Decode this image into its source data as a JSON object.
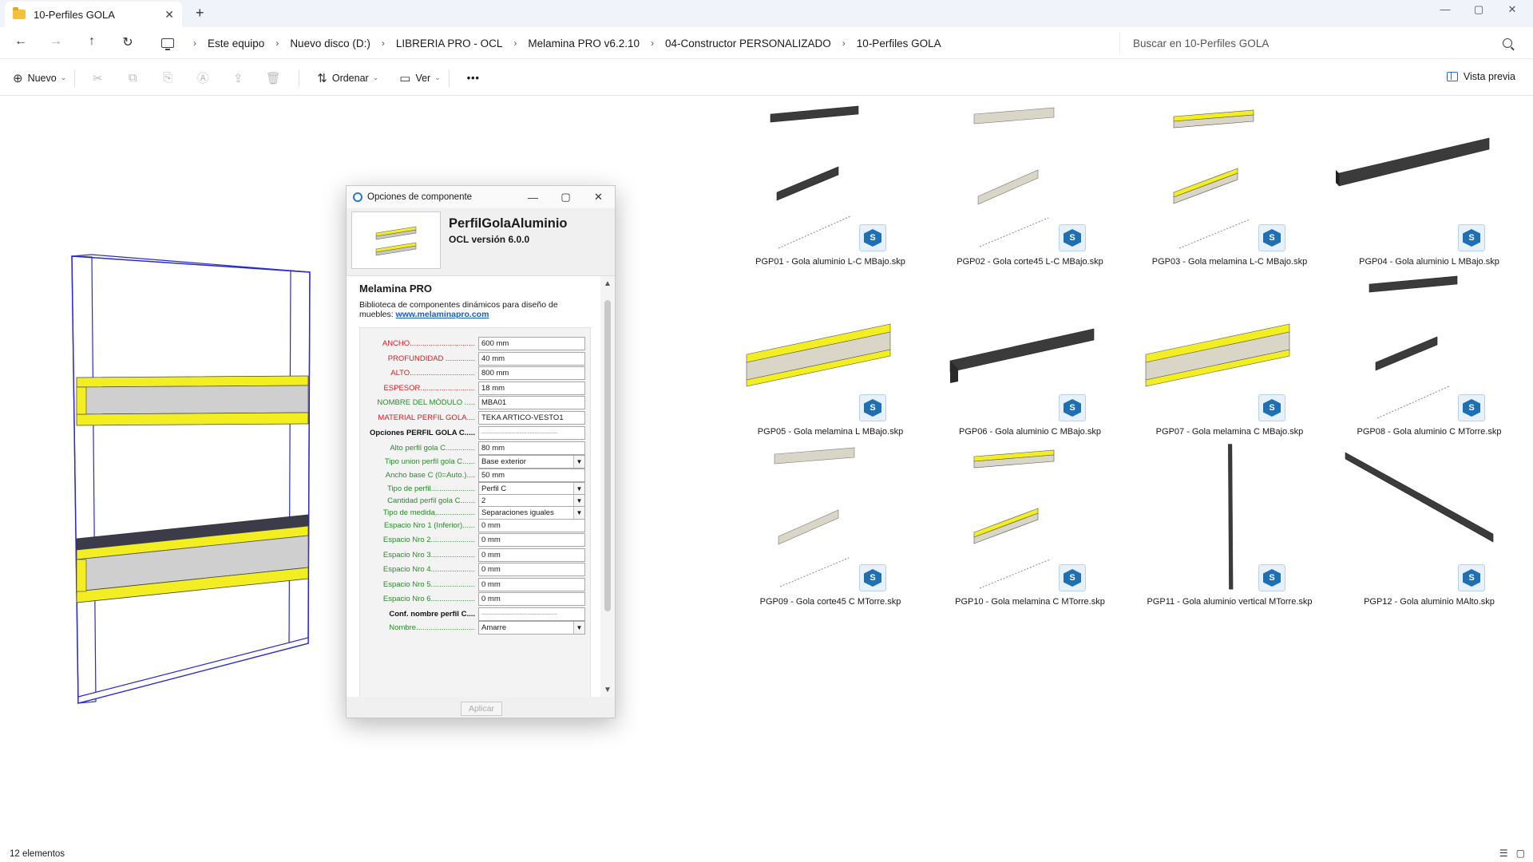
{
  "window": {
    "tab_title": "10-Perfiles GOLA",
    "tab_close": "✕",
    "new_tab": "+",
    "controls": {
      "minimize": "—",
      "maximize": "▢",
      "close": "✕"
    }
  },
  "nav": {
    "back": "←",
    "forward": "→",
    "up": "↑",
    "refresh": "↻",
    "breadcrumbs": [
      "Este equipo",
      "Nuevo disco (D:)",
      "LIBRERIA PRO - OCL",
      "Melamina PRO v6.2.10",
      "04-Constructor PERSONALIZADO",
      "10-Perfiles GOLA"
    ],
    "separator": "›",
    "search_placeholder": "Buscar en 10-Perfiles GOLA"
  },
  "commandbar": {
    "new_label": "Nuevo",
    "new_icon": "⊕",
    "sort_label": "Ordenar",
    "sort_icon": "⇅",
    "view_label": "Ver",
    "view_icon": "▭",
    "more": "•••",
    "preview_label": "Vista previa",
    "icons": [
      "✂",
      "⧉",
      "⎘",
      "Ⓐ",
      "⇪",
      "🗑"
    ]
  },
  "dialog": {
    "title": "Opciones de componente",
    "controls": {
      "minimize": "—",
      "maximize": "▢",
      "close": "✕"
    },
    "component_name": "PerfilGolaAluminio",
    "version": "OCL versión 6.0.0",
    "brand": "Melamina PRO",
    "description": "Biblioteca de componentes dinámicos para diseño de muebles:",
    "link": "www.melaminapro.com",
    "apply_label": "Aplicar",
    "fields": [
      {
        "label": "ANCHO...............................",
        "value": "600 mm",
        "color": "red",
        "type": "input"
      },
      {
        "label": "PROFUNDIDAD ..............",
        "value": "40 mm",
        "color": "red",
        "type": "input"
      },
      {
        "label": "ALTO...............................",
        "value": "800 mm",
        "color": "red",
        "type": "input"
      },
      {
        "label": "ESPESOR..........................",
        "value": "18 mm",
        "color": "red",
        "type": "input"
      },
      {
        "label": "NOMBRE DEL MÓDULO .....",
        "value": "MBA01",
        "color": "green",
        "type": "input"
      },
      {
        "label": "MATERIAL PERFIL GOLA....",
        "value": "TEKA ARTICO-VESTO1",
        "color": "red",
        "type": "input"
      },
      {
        "label": "Opciones PERFIL GOLA C.....",
        "value": "------------------------------",
        "color": "bold",
        "type": "dashed"
      },
      {
        "label": "Alto perfil gola C..............",
        "value": "80 mm",
        "color": "green",
        "type": "input"
      },
      {
        "label": "Tipo union perfil gola C......",
        "value": "Base exterior",
        "color": "green",
        "type": "select"
      },
      {
        "label": "Ancho base C (0=Auto.)....",
        "value": "50 mm",
        "color": "green",
        "type": "input"
      },
      {
        "label": "Tipo de perfil.....................",
        "value": "Perfil C",
        "color": "green",
        "type": "select"
      },
      {
        "label": "Cantidad perfil gola C.......",
        "value": "2",
        "color": "green",
        "type": "select"
      },
      {
        "label": "Tipo de medida...................",
        "value": "Separaciones iguales",
        "color": "green",
        "type": "select"
      },
      {
        "label": "Espacio Nro 1 (Inferior)......",
        "value": "0 mm",
        "color": "green",
        "type": "input"
      },
      {
        "label": "Espacio Nro 2.....................",
        "value": "0 mm",
        "color": "green",
        "type": "input"
      },
      {
        "label": "Espacio Nro 3.....................",
        "value": "0 mm",
        "color": "green",
        "type": "input"
      },
      {
        "label": "Espacio Nro 4.....................",
        "value": "0 mm",
        "color": "green",
        "type": "input"
      },
      {
        "label": "Espacio Nro 5.....................",
        "value": "0 mm",
        "color": "green",
        "type": "input"
      },
      {
        "label": "Espacio Nro 6.....................",
        "value": "0 mm",
        "color": "green",
        "type": "input"
      },
      {
        "label": "Conf. nombre perfil C....",
        "value": "------------------------------",
        "color": "bold",
        "type": "dashed"
      },
      {
        "label": "Nombre............................",
        "value": "Amarre",
        "color": "green",
        "type": "select"
      }
    ]
  },
  "files": [
    {
      "name": "PGP01 - Gola aluminio L-C MBajo.skp",
      "style": "dark-pair"
    },
    {
      "name": "PGP02 - Gola corte45 L-C MBajo.skp",
      "style": "light-pair"
    },
    {
      "name": "PGP03 - Gola melamina L-C MBajo.skp",
      "style": "yellow-pair"
    },
    {
      "name": "PGP04 - Gola aluminio L MBajo.skp",
      "style": "dark-long"
    },
    {
      "name": "PGP05 - Gola melamina L MBajo.skp",
      "style": "yellow-big"
    },
    {
      "name": "PGP06 - Gola aluminio C MBajo.skp",
      "style": "dark-big"
    },
    {
      "name": "PGP07 - Gola melamina C MBajo.skp",
      "style": "yellow-big"
    },
    {
      "name": "PGP08 - Gola aluminio C MTorre.skp",
      "style": "dark-pair"
    },
    {
      "name": "PGP09 - Gola corte45 C MTorre.skp",
      "style": "light-pair"
    },
    {
      "name": "PGP10 - Gola melamina C MTorre.skp",
      "style": "yellow-pair"
    },
    {
      "name": "PGP11 - Gola aluminio vertical MTorre.skp",
      "style": "dark-vertical"
    },
    {
      "name": "PGP12 - Gola aluminio MAlto.skp",
      "style": "dark-diagonal"
    }
  ],
  "skp_badge_letter": "S",
  "status": {
    "count": "12 elementos"
  },
  "colors": {
    "accent": "#1f6fb3",
    "melamine_yellow": "#f2ee22",
    "aluminium_dark": "#3b3b3b",
    "frame_blue": "#2a2ac8"
  }
}
